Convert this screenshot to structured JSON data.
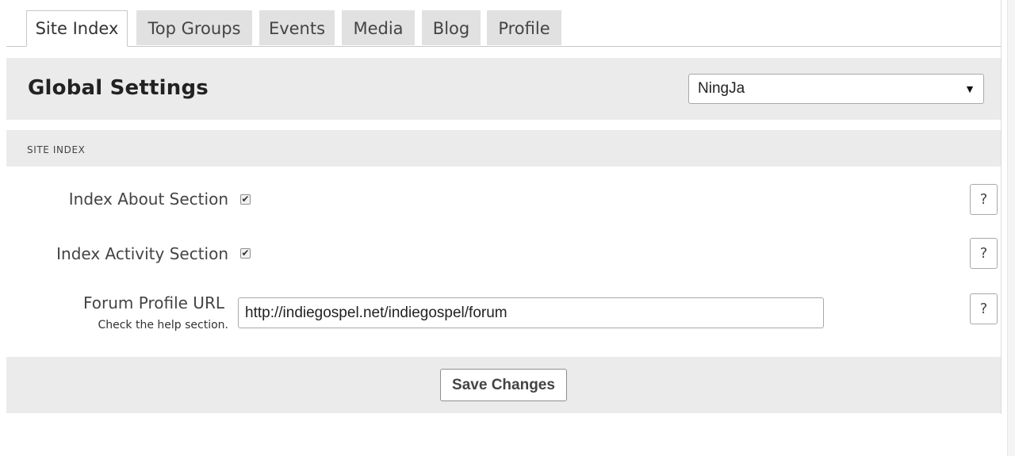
{
  "tabs": [
    {
      "label": "Site Index",
      "active": true
    },
    {
      "label": "Top Groups"
    },
    {
      "label": "Events"
    },
    {
      "label": "Media"
    },
    {
      "label": "Blog"
    },
    {
      "label": "Profile"
    }
  ],
  "header": {
    "title": "Global Settings",
    "theme_select": {
      "selected": "NingJa",
      "arrow": "▼"
    }
  },
  "section": {
    "title": "SITE INDEX",
    "rows": [
      {
        "label": "Index About Section",
        "checked": true,
        "check_glyph": "✔"
      },
      {
        "label": "Index Activity Section",
        "checked": true,
        "check_glyph": "✔"
      },
      {
        "label": "Forum Profile URL",
        "sublabel": "Check the help section.",
        "value": "http://indiegospel.net/indiegospel/forum"
      }
    ],
    "help_label": "?"
  },
  "footer": {
    "save_label": "Save Changes"
  }
}
